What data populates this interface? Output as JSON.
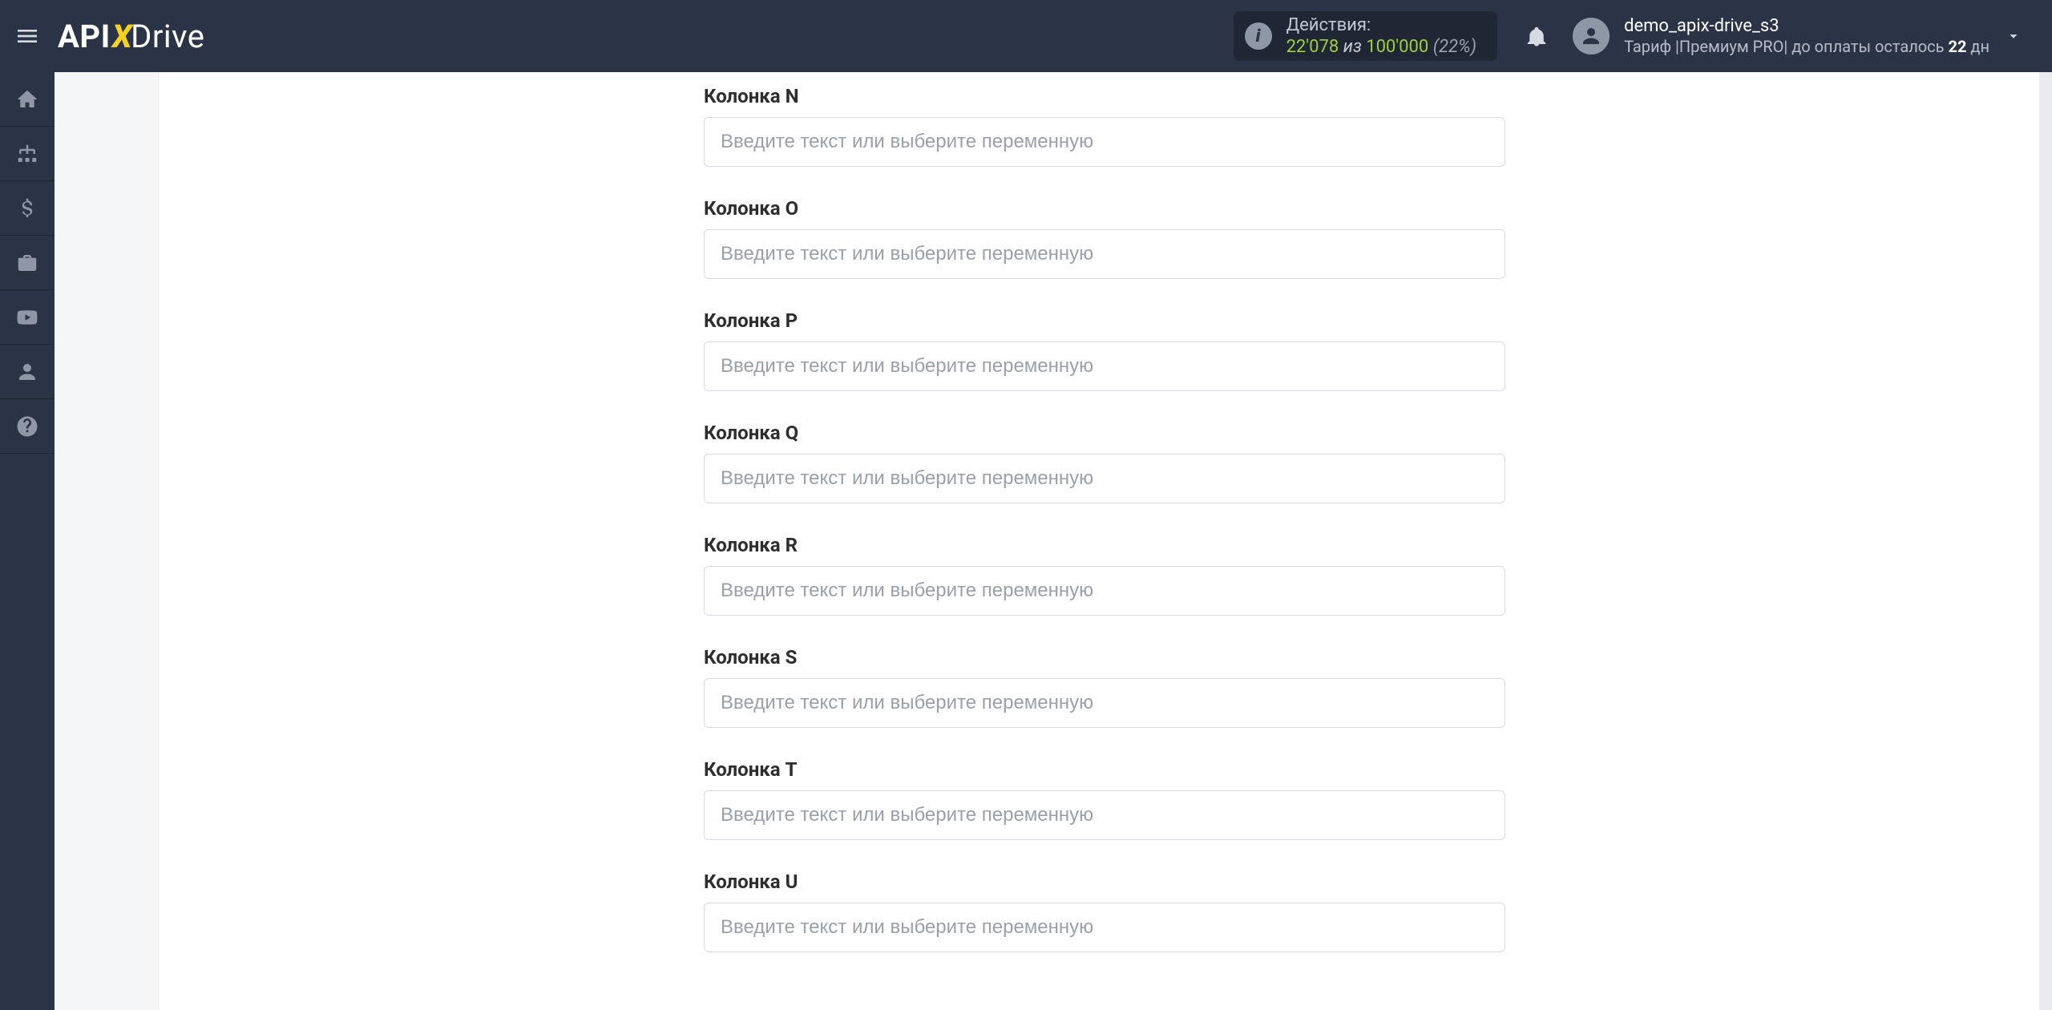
{
  "brand": {
    "left": "API",
    "mid": "X",
    "right": "Drive"
  },
  "header": {
    "actions_label": "Действия:",
    "actions_used": "22'078",
    "actions_of": " из ",
    "actions_limit": "100'000",
    "actions_pct": "(22%)"
  },
  "account": {
    "username": "demo_apix-drive_s3",
    "plan_prefix": "Тариф |",
    "plan_name": "Премиум PRO",
    "plan_mid": "| до оплаты осталось ",
    "plan_days": "22",
    "plan_suffix": " дн"
  },
  "form": {
    "placeholder": "Введите текст или выберите переменную",
    "fields": [
      {
        "label": "Колонка N"
      },
      {
        "label": "Колонка O"
      },
      {
        "label": "Колонка P"
      },
      {
        "label": "Колонка Q"
      },
      {
        "label": "Колонка R"
      },
      {
        "label": "Колонка S"
      },
      {
        "label": "Колонка T"
      },
      {
        "label": "Колонка U"
      }
    ]
  },
  "sidebar": {
    "items": [
      {
        "name": "home"
      },
      {
        "name": "connections"
      },
      {
        "name": "billing"
      },
      {
        "name": "briefcase"
      },
      {
        "name": "youtube"
      },
      {
        "name": "profile"
      },
      {
        "name": "help"
      }
    ]
  }
}
